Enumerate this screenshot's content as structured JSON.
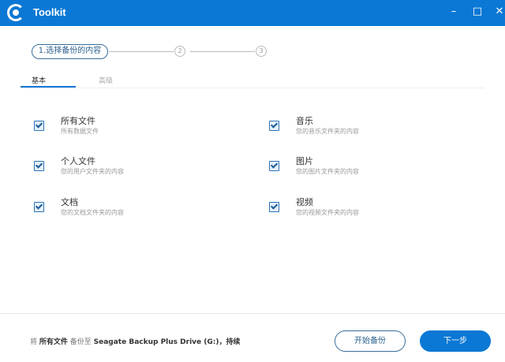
{
  "window": {
    "title": "Toolkit"
  },
  "stepper": {
    "step1": "1.选择备份的内容",
    "step2": "2",
    "step3": "3"
  },
  "tabs": [
    {
      "label": "基本",
      "active": true
    },
    {
      "label": "高级",
      "active": false
    }
  ],
  "items": [
    {
      "title": "所有文件",
      "subtitle": "所有数据文件",
      "checked": true
    },
    {
      "title": "个人文件",
      "subtitle": "您的用户文件夹的内容",
      "checked": true
    },
    {
      "title": "文档",
      "subtitle": "您的文档文件夹的内容",
      "checked": true
    },
    {
      "title": "音乐",
      "subtitle": "您的音乐文件夹的内容",
      "checked": true
    },
    {
      "title": "图片",
      "subtitle": "您的图片文件夹的内容",
      "checked": true
    },
    {
      "title": "视频",
      "subtitle": "您的视频文件夹的内容",
      "checked": true
    }
  ],
  "footer": {
    "p1": "将 ",
    "what": "所有文件",
    "p2": " 备份至 ",
    "drive": "Seagate Backup Plus Drive (G:)",
    "p3": "，持续"
  },
  "buttons": {
    "start": "开始备份",
    "next": "下一步"
  },
  "colors": {
    "accent": "#0a78d4"
  }
}
